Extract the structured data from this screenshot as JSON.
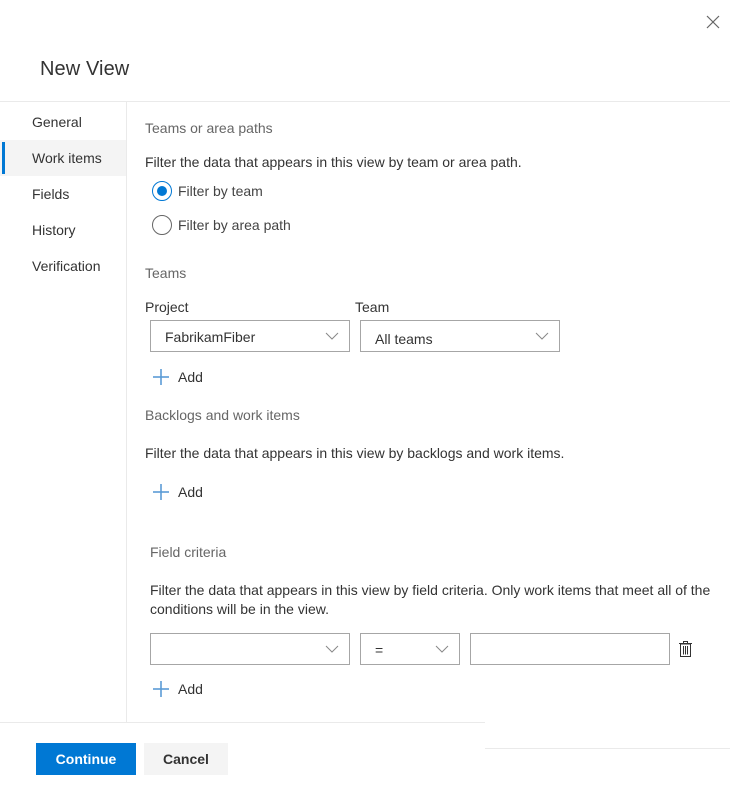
{
  "dialog": {
    "title": "New View",
    "close_icon": "close-icon"
  },
  "nav": {
    "items": [
      {
        "label": "General",
        "active": false
      },
      {
        "label": "Work items",
        "active": true
      },
      {
        "label": "Fields",
        "active": false
      },
      {
        "label": "History",
        "active": false
      },
      {
        "label": "Verification",
        "active": false
      }
    ]
  },
  "teams_or_area_paths": {
    "heading": "Teams or area paths",
    "description": "Filter the data that appears in this view by team or area path.",
    "options": [
      {
        "label": "Filter by team",
        "checked": true
      },
      {
        "label": "Filter by area path",
        "checked": false
      }
    ]
  },
  "teams": {
    "heading": "Teams",
    "project_label": "Project",
    "project_value": "FabrikamFiber",
    "team_label": "Team",
    "team_value": "All teams",
    "add_label": "Add"
  },
  "backlogs": {
    "heading": "Backlogs and work items",
    "description": "Filter the data that appears in this view by backlogs and work items.",
    "add_label": "Add"
  },
  "field_criteria": {
    "heading": "Field criteria",
    "description_line1": "Filter the data that appears in this view by field criteria. Only work items that meet all of the",
    "description_line2": "conditions will be in the view.",
    "row": {
      "field_value": "",
      "operator_value": "=",
      "value": ""
    },
    "add_label": "Add"
  },
  "footer": {
    "continue_label": "Continue",
    "cancel_label": "Cancel"
  },
  "colors": {
    "accent": "#0078d4",
    "add_icon": "#5b9bd5",
    "secondary_button": "#f4f4f4"
  }
}
